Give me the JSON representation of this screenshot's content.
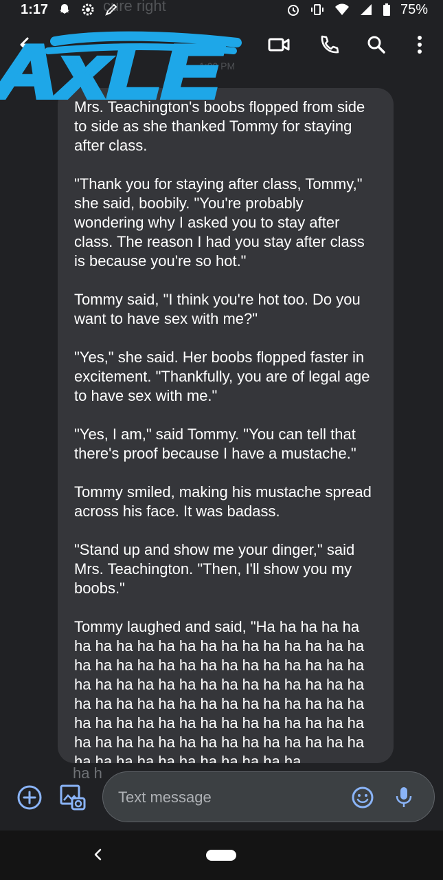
{
  "status_bar": {
    "time": "1:17",
    "battery": "75%",
    "icons_left": [
      "snapchat-icon",
      "settings-icon",
      "edit-icon"
    ],
    "icons_right": [
      "alarm-icon",
      "vibrate-icon",
      "wifi-icon",
      "signal-icon",
      "battery-icon"
    ]
  },
  "header": {
    "ghost_title": "cure right",
    "ghost_time": "1:00 PM",
    "contact_scribble": "AxLE"
  },
  "message": {
    "paragraphs": [
      "Mrs. Teachington's boobs flopped from side to side as she thanked Tommy for staying after class.",
      "\"Thank you for staying after class, Tommy,\" she said, boobily. \"You're probably wondering why I asked you to stay after class. The reason I had you stay after class is because you're so hot.\"",
      "Tommy said, \"I think you're hot too. Do you want to have sex with me?\"",
      "\"Yes,\" she said. Her boobs flopped faster in excitement. \"Thankfully, you are of legal age to have sex with me.\"",
      "\"Yes, I am,\" said Tommy. \"You can tell that there's proof because I have a mustache.\"",
      "Tommy smiled, making his mustache spread across his face. It was badass.",
      "\"Stand up and show me your dinger,\" said Mrs. Teachington. \"Then, I'll show you my boobs.\"",
      "Tommy laughed and said, \"Ha ha ha ha ha ha ha ha ha ha ha ha ha ha ha ha ha ha ha ha ha ha ha ha ha ha ha ha ha ha ha ha ha ha ha ha ha ha ha ha ha ha ha ha ha ha ha ha ha ha ha ha ha ha ha ha ha ha ha ha ha ha ha ha ha ha ha ha ha ha ha ha ha ha ha ha ha ha ha ha ha ha ha ha ha ha ha ha ha ha ha ha ha ha ha ha ha ha ha ha"
    ],
    "underlay_fragment": "ha h"
  },
  "compose": {
    "placeholder": "Text message"
  },
  "colors": {
    "background": "#202124",
    "bubble": "#35363a",
    "accent": "#8ab4f8",
    "scribble": "#1ea7e8"
  }
}
